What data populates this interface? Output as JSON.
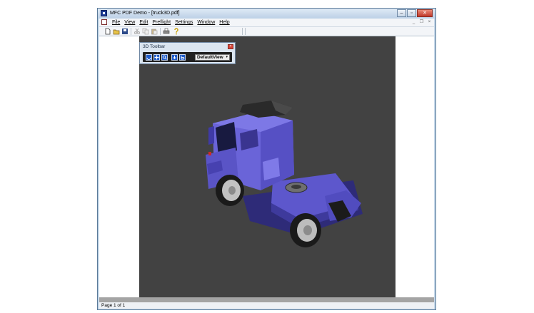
{
  "window": {
    "title": "MFC PDF Demo - [truck3D.pdf]"
  },
  "title_buttons": {
    "minimize": "–",
    "maximize": "▫",
    "close": "✕"
  },
  "menu": {
    "items": [
      "File",
      "View",
      "Edit",
      "Preflight",
      "Settings",
      "Window",
      "Help"
    ]
  },
  "mdi_buttons": {
    "minimize": "_",
    "restore": "❐",
    "close": "×"
  },
  "toolbar": {
    "icons": [
      "new-document-icon",
      "open-folder-icon",
      "save-icon",
      "cut-icon",
      "copy-icon",
      "paste-icon",
      "print-icon",
      "help-icon"
    ]
  },
  "panel3d": {
    "title": "3D Toolbar",
    "close": "×",
    "view_value": "DefaultView",
    "view_arrow": "▾",
    "buttons": [
      "rotate-icon",
      "pan-icon",
      "zoom-icon",
      "walk-icon",
      "fly-icon"
    ]
  },
  "status": {
    "text": "Page 1 of 1"
  },
  "colors": {
    "truck": "#5b55c9",
    "canvas": "#424242",
    "toolbar_button": "#1f5cc9"
  }
}
